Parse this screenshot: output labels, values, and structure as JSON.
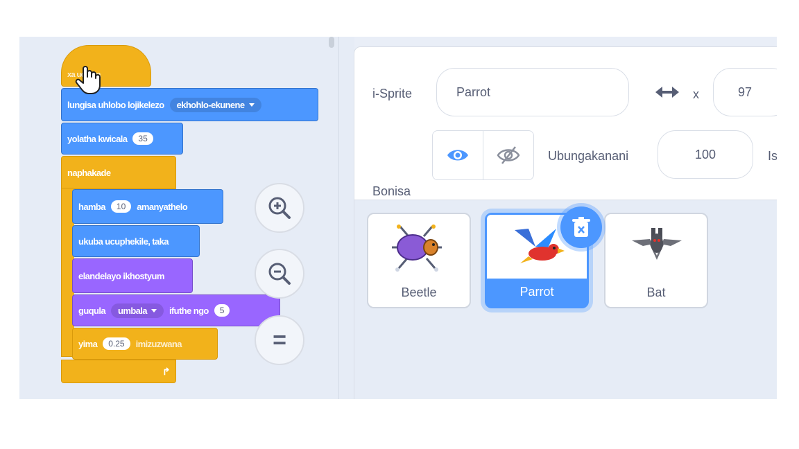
{
  "blocks": {
    "hat_label": "xa        ucofwa",
    "set_rotation_label": "lungisa uhlobo lojikelezo",
    "set_rotation_value": "ekhohlo-ekunene",
    "size_label": "yolatha kwicala",
    "size_value": "35",
    "forever_label": "naphakade",
    "move_label": "hamba",
    "move_value": "10",
    "move_suffix": "amanyathelo",
    "bounce_label": "ukuba ucuphekile, taka",
    "next_costume_label": "elandelayo ikhostyum",
    "change_effect_label": "guqula",
    "change_effect_dd": "umbala",
    "change_effect_mid": "ifuthe ngo",
    "change_effect_value": "5",
    "wait_label": "yima",
    "wait_value": "0.25",
    "wait_suffix": "imizuzwana"
  },
  "zoom": {
    "zoom_in": "zoom-in-icon",
    "zoom_out": "zoom-out-icon",
    "reset": "="
  },
  "sprite_info": {
    "sprite_label": "i-Sprite",
    "sprite_name": "Parrot",
    "x_label": "x",
    "x_value": "97",
    "show_label": "Bonisa",
    "size_label": "Ubungakanani",
    "size_value": "100",
    "cut_text": "Is"
  },
  "sprites": [
    {
      "name": "Beetle"
    },
    {
      "name": "Parrot"
    },
    {
      "name": "Bat"
    }
  ],
  "colors": {
    "events": "#f2b21b",
    "motion": "#4c97ff",
    "looks": "#9966ff",
    "accent": "#4c97ff"
  }
}
